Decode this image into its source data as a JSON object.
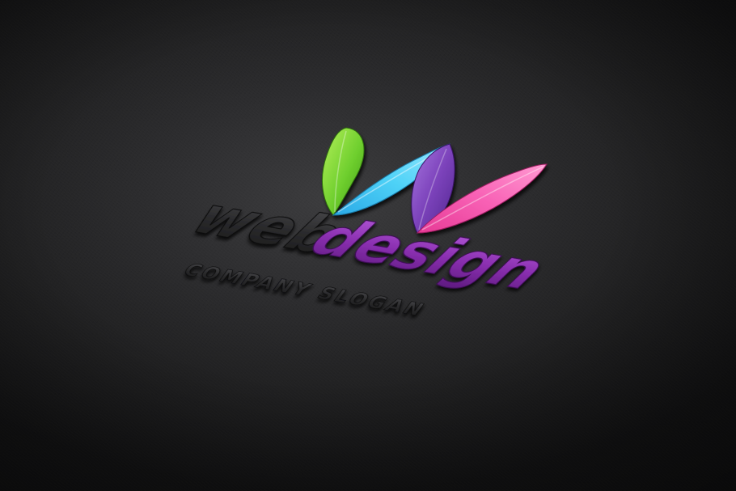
{
  "logo": {
    "word_part_1": "web",
    "word_part_2": "design",
    "slogan": "COMPANY SLOGAN",
    "mark_icon": "w-leaf-mark",
    "colors": {
      "background": "#2d2d2f",
      "word_dark": "#2a2a2c",
      "word_accent": "#8a2fb0",
      "leaf_green": "#7bd33a",
      "leaf_cyan": "#38c8f0",
      "leaf_purple": "#7a3fb4",
      "leaf_pink": "#f04fa8"
    }
  }
}
